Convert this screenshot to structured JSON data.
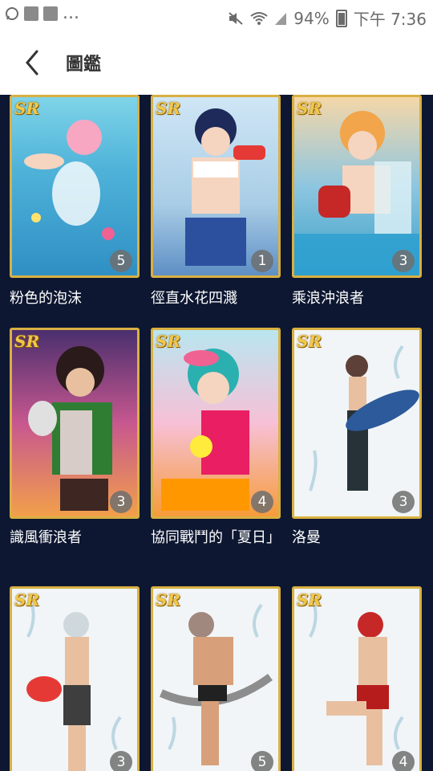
{
  "status_bar": {
    "ellipsis": "...",
    "battery": "94%",
    "time": "下午 7:36"
  },
  "header": {
    "title": "圖鑑"
  },
  "cards": [
    {
      "name": "粉色的泡沫",
      "rarity": "SR",
      "count": "5"
    },
    {
      "name": "徑直水花四濺",
      "rarity": "SR",
      "count": "1"
    },
    {
      "name": "乘浪沖浪者",
      "rarity": "SR",
      "count": "3"
    },
    {
      "name": "識風衝浪者",
      "rarity": "SR",
      "count": "3"
    },
    {
      "name": "協同戰鬥的「夏日」",
      "rarity": "SR",
      "count": "4"
    },
    {
      "name": "洛曼",
      "rarity": "SR",
      "count": "3"
    },
    {
      "name": "",
      "rarity": "SR",
      "count": "3"
    },
    {
      "name": "",
      "rarity": "SR",
      "count": "5"
    },
    {
      "name": "",
      "rarity": "SR",
      "count": "4"
    }
  ]
}
